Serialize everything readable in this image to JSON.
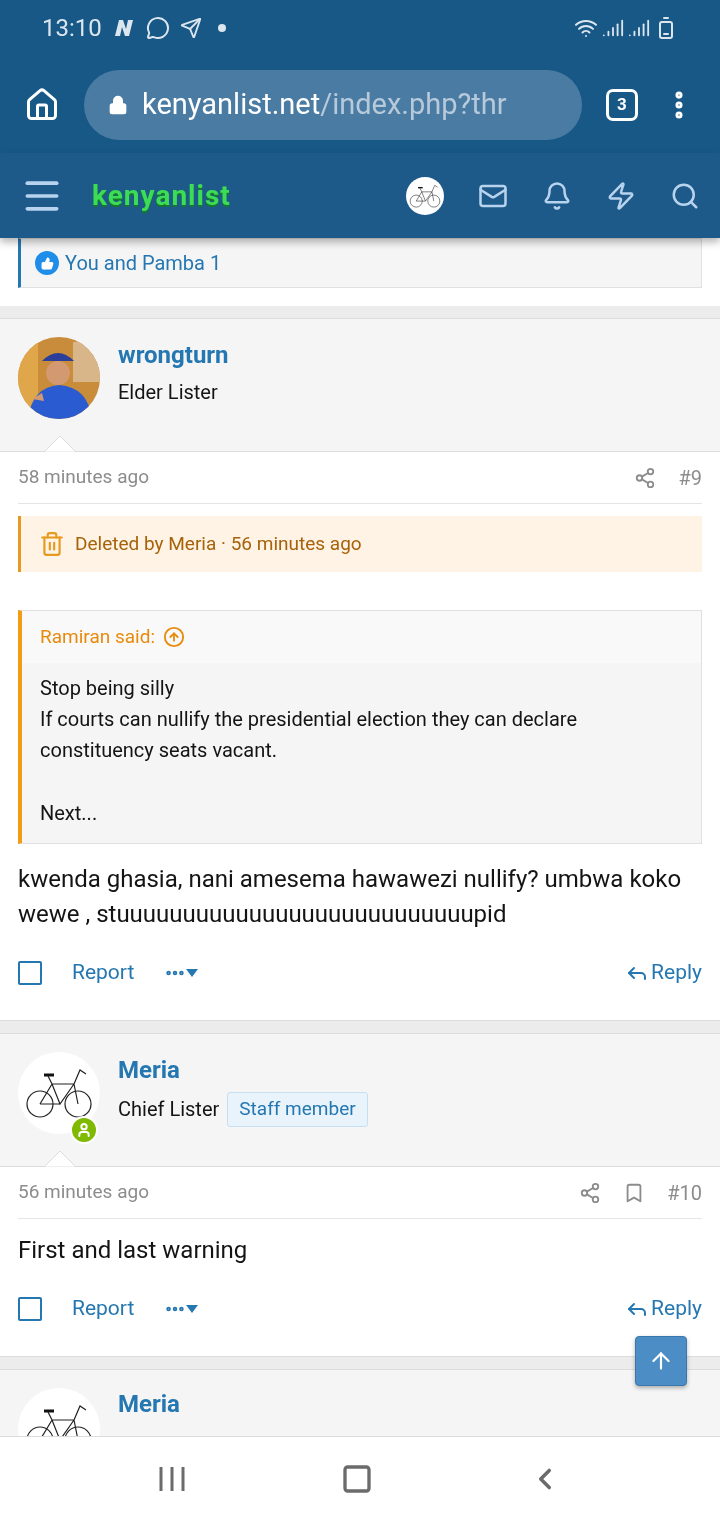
{
  "status_bar": {
    "time": "13:10"
  },
  "browser": {
    "url_host": "kenyanlist.net",
    "url_path": "/index.php?thr",
    "tab_count": "3"
  },
  "site_header": {
    "logo": "kenyanlist"
  },
  "reactions": {
    "text": "You and Pamba 1"
  },
  "posts": [
    {
      "author": "wrongturn",
      "title": "Elder Lister",
      "online": false,
      "time": "58 minutes ago",
      "bookmark": false,
      "number": "#9",
      "deleted_notice": "Deleted by Meria · 56 minutes ago",
      "quote": {
        "author": "Ramiran said:",
        "paragraphs": [
          "Stop being silly\nIf courts can nullify the presidential election they can declare constituency seats vacant.",
          "Next..."
        ]
      },
      "body": "kwenda ghasia, nani amesema hawawezi nullify? umbwa koko wewe , stuuuuuuuuuuuuuuuuuuuuuuuuuuupid",
      "checked": false,
      "report": "Report",
      "reply": "Reply"
    },
    {
      "author": "Meria",
      "title": "Chief Lister",
      "badge": "Staff member",
      "avatar": {
        "kind": "bicycle"
      },
      "online": true,
      "time": "56 minutes ago",
      "bookmark": true,
      "number": "#10",
      "body": "First and last warning",
      "checked": false,
      "report": "Report",
      "reply": "Reply"
    }
  ],
  "next_post": {
    "author": "Meria",
    "avatar": {
      "kind": "bicycle"
    }
  }
}
